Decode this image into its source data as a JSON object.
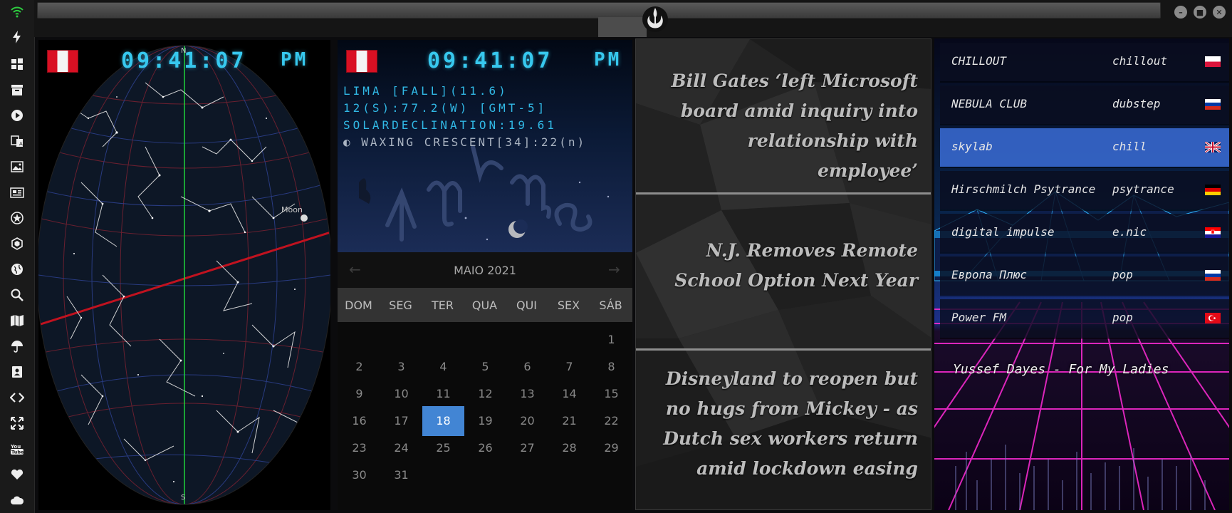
{
  "colors": {
    "clock_cyan": "#37c8ee",
    "calendar_selected": "#4285d4",
    "radio_active": "#3a6cd6",
    "sky_meridian": "#1fd13a",
    "sky_ecliptic": "#c0121f"
  },
  "sidebar": {
    "icons": [
      "wifi-icon",
      "flash-icon",
      "windows-icon",
      "archive-icon",
      "play-icon",
      "translate-icon",
      "image-icon",
      "news-icon",
      "star-icon",
      "hexagon-icon",
      "globe-icon",
      "search-icon",
      "map-icon",
      "umbrella-icon",
      "contacts-icon",
      "code-icon",
      "expand-icon",
      "youtube-icon",
      "heart-icon",
      "cloud-icon"
    ]
  },
  "topbar": {
    "logo": "rebel-alliance-logo",
    "window_controls": [
      "minimize-icon",
      "maximize-icon",
      "close-icon"
    ]
  },
  "sky": {
    "flag": "peru-flag",
    "clock_time": "09:41:07",
    "clock_ampm": "PM",
    "north_label": "N",
    "south_label": "S",
    "moon_label": "Moon"
  },
  "info": {
    "flag": "peru-flag",
    "clock_time": "09:41:07",
    "clock_ampm": "PM",
    "line1": "LIMA [FALL](11.6)",
    "line2": "12(S):77.2(W) [GMT-5]",
    "line3": "SOLARDECLINATION:19.61",
    "moon_phase": "WAXING CRESCENT[34]:22(n)"
  },
  "calendar": {
    "month_label": "MAIO 2021",
    "prev_icon": "←",
    "next_icon": "→",
    "weekdays": [
      "DOM",
      "SEG",
      "TER",
      "QUA",
      "QUI",
      "SEX",
      "SÁB"
    ],
    "first_weekday_index": 6,
    "days_in_month": 31,
    "selected_day": 18
  },
  "news": {
    "headlines": [
      "Bill Gates ‘left Microsoft board amid inquiry into relationship with employee’",
      "N.J. Removes Remote School Option Next Year",
      "Disneyland to reopen but no hugs from Mickey - as Dutch sex workers return amid lockdown easing"
    ]
  },
  "radio": {
    "stations": [
      {
        "name": "CHILLOUT",
        "genre": "chillout",
        "flag": "poland-flag",
        "active": false
      },
      {
        "name": "NEBULA CLUB",
        "genre": "dubstep",
        "flag": "russia-flag",
        "active": false
      },
      {
        "name": "skylab",
        "genre": "chill",
        "flag": "uk-flag",
        "active": true
      },
      {
        "name": "Hirschmilch Psytrance",
        "genre": "psytrance",
        "flag": "germany-flag",
        "active": false
      },
      {
        "name": "digital impulse",
        "genre": "e.nic",
        "flag": "croatia-flag",
        "active": false
      },
      {
        "name": "Европа Плюс",
        "genre": "pop",
        "flag": "russia-flag",
        "active": false
      },
      {
        "name": "Power FM",
        "genre": "pop",
        "flag": "turkey-flag",
        "active": false
      }
    ],
    "now_playing": "Yussef Dayes - For My Ladies"
  }
}
